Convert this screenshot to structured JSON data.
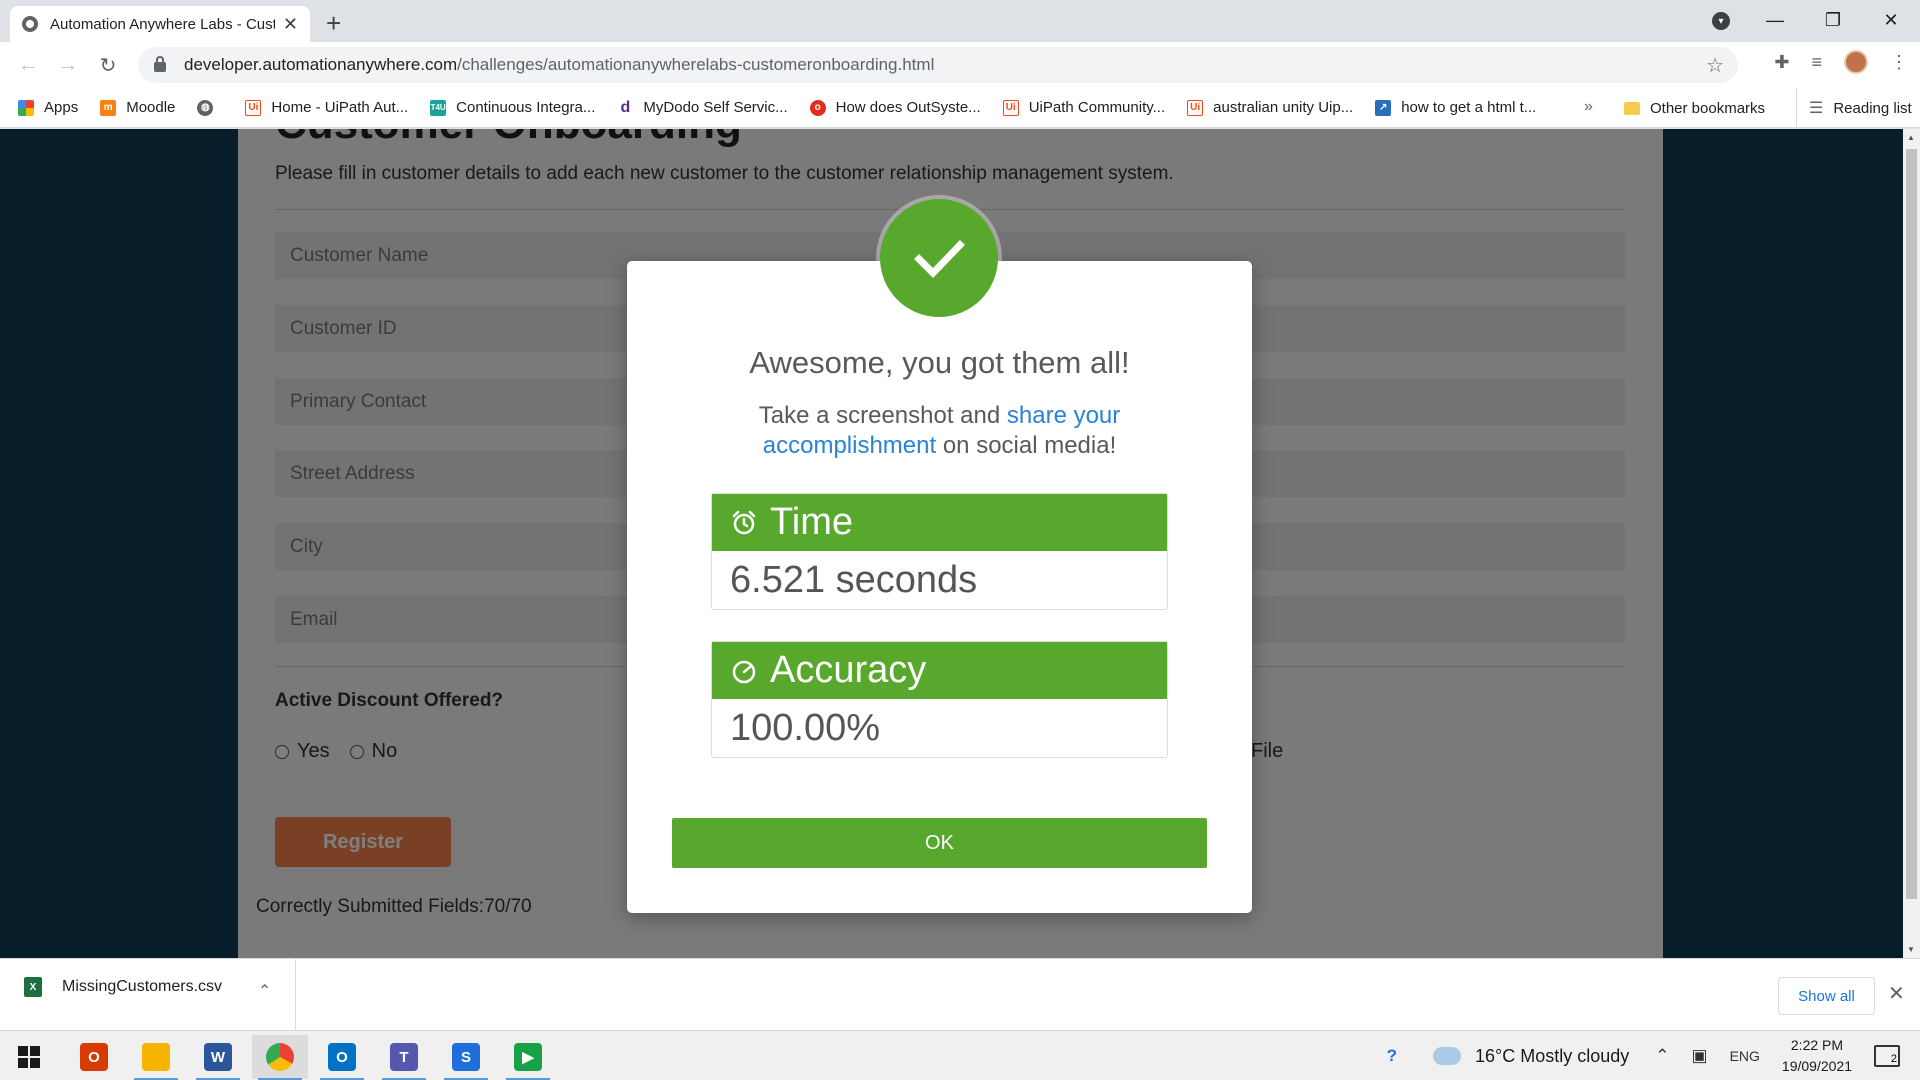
{
  "browser": {
    "tab_title": "Automation Anywhere Labs - Customer Onboarding",
    "new_tab_icon": "+",
    "url_domain": "developer.automationanywhere.com",
    "url_path": "/challenges/automationanywherelabs-customeronboarding.html",
    "bookmarks": [
      {
        "label": "Apps",
        "icon": "apps-grid",
        "color": "#4285f4"
      },
      {
        "label": "Moodle",
        "icon": "moodle",
        "color": "#f98012"
      },
      {
        "label": "",
        "icon": "globe",
        "color": "#5f6368"
      },
      {
        "label": "Home - UiPath Aut...",
        "icon": "uipath",
        "color": "#fa4616"
      },
      {
        "label": "Continuous Integra...",
        "icon": "t4u",
        "color": "#1aa39a"
      },
      {
        "label": "MyDodo Self Servic...",
        "icon": "dodo",
        "color": "#5a2a8c"
      },
      {
        "label": "How does OutSyste...",
        "icon": "outsystems",
        "color": "#e52a1b"
      },
      {
        "label": "UiPath Community...",
        "icon": "uipath",
        "color": "#fa4616"
      },
      {
        "label": "australian unity Uip...",
        "icon": "uipath",
        "color": "#fa4616"
      },
      {
        "label": "how to get a html t...",
        "icon": "link",
        "color": "#2a6ebb"
      }
    ],
    "bookmarks_more": "»",
    "other_bookmarks": "Other bookmarks",
    "reading_list": "Reading list"
  },
  "page": {
    "heading": "Customer Onboarding",
    "description": "Please fill in customer details to add each new customer to the customer relationship management system.",
    "fields": [
      "Customer Name",
      "Customer ID",
      "Primary Contact",
      "Street Address",
      "City",
      "Email"
    ],
    "discount_question": "Active Discount Offered?",
    "radio_yes": "Yes",
    "radio_no": "No",
    "file_label": "File",
    "register_button": "Register",
    "submitted_text": "Correctly Submitted Fields:70/70"
  },
  "modal": {
    "title": "Awesome, you got them all!",
    "text_before": "Take a screenshot and ",
    "link_text": "share your accomplishment",
    "text_after": " on social media!",
    "time_label": "Time",
    "time_value": "6.521 seconds",
    "accuracy_label": "Accuracy",
    "accuracy_value": "100.00%",
    "ok_button": "OK",
    "accent_color": "#58a82d"
  },
  "downloads": {
    "file_name": "MissingCustomers.csv",
    "show_all": "Show all"
  },
  "taskbar": {
    "apps": [
      {
        "name": "office",
        "label": "O",
        "color": "#d83b01"
      },
      {
        "name": "file-explorer",
        "label": "",
        "color": "#f4b400"
      },
      {
        "name": "word",
        "label": "W",
        "color": "#2b579a"
      },
      {
        "name": "chrome",
        "label": "",
        "color": "#4285f4"
      },
      {
        "name": "outlook",
        "label": "O",
        "color": "#0072c6"
      },
      {
        "name": "teams",
        "label": "T",
        "color": "#5558af"
      },
      {
        "name": "skype",
        "label": "S",
        "color": "#1e6fd9"
      },
      {
        "name": "media-player",
        "label": "▶",
        "color": "#17a24a"
      }
    ],
    "weather": "16°C  Mostly cloudy",
    "language": "ENG",
    "time": "2:22 PM",
    "date": "19/09/2021",
    "notifications": "2"
  }
}
